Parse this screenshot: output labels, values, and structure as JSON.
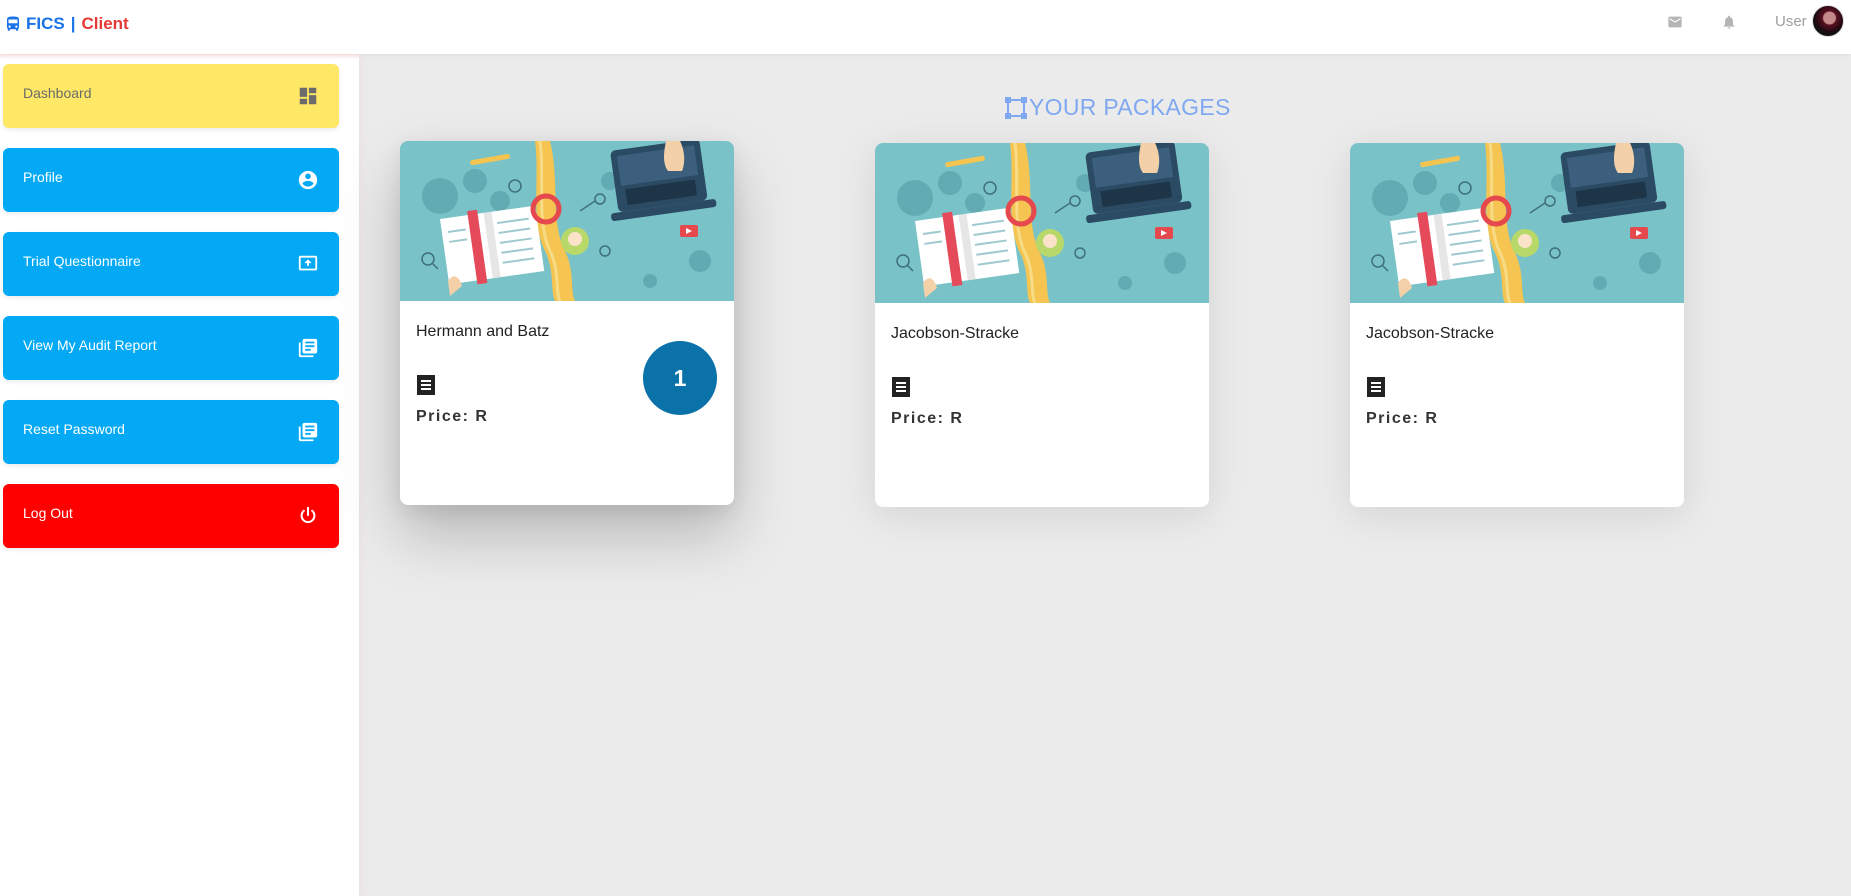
{
  "brand": {
    "part1": "FICS",
    "separator": "|",
    "part2": "Client"
  },
  "header": {
    "username": "User"
  },
  "sidebar": {
    "items": [
      {
        "label": "Dashboard"
      },
      {
        "label": "Profile"
      },
      {
        "label": "Trial Questionnaire"
      },
      {
        "label": "View My Audit Report"
      },
      {
        "label": "Reset Password"
      },
      {
        "label": "Log Out"
      }
    ]
  },
  "main": {
    "title": "YOUR PACKAGES",
    "packages": [
      {
        "name": "Hermann and Batz",
        "price": "Price: R",
        "badge": "1"
      },
      {
        "name": "Jacobson-Stracke",
        "price": "Price: R"
      },
      {
        "name": "Jacobson-Stracke",
        "price": "Price: R"
      }
    ]
  },
  "colors": {
    "dashboard": "#ffe866",
    "nav": "#03a9f4",
    "logout": "#ff0000",
    "badge": "#0a72a9",
    "title": "#7fa8f0",
    "brand_blue": "#1a73e8",
    "brand_red": "#e53935"
  },
  "icons": {
    "brand": "bus-icon",
    "mail": "mail-icon",
    "bell": "bell-icon",
    "dashboard": "dashboard-grid-icon",
    "profile": "account-circle-icon",
    "trial": "upload-screen-icon",
    "audit": "library-books-icon",
    "reset": "library-books-icon",
    "logout": "power-icon",
    "card": "receipt-icon",
    "title": "frame-icon"
  }
}
